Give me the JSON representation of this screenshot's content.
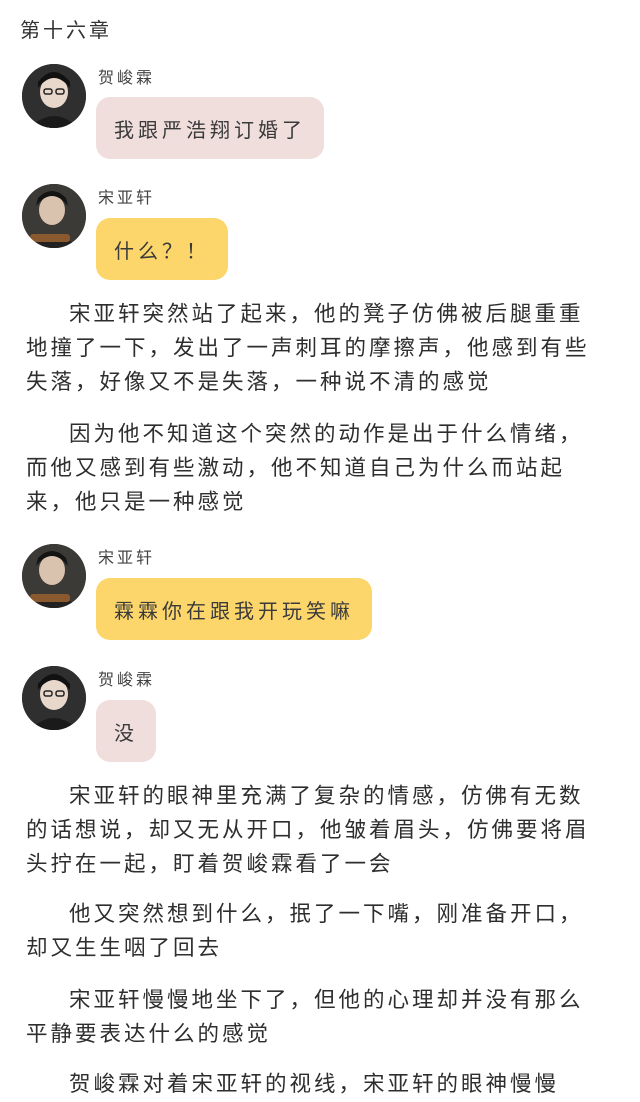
{
  "chapter": {
    "title": "第十六章"
  },
  "messages": [
    {
      "sender": "贺峻霖",
      "text": "我跟严浩翔订婚了",
      "color": "#f0dedd"
    },
    {
      "sender": "宋亚轩",
      "text": "什么？！",
      "color": "#fcd66a"
    },
    {
      "sender": "宋亚轩",
      "text": "霖霖你在跟我开玩笑嘛",
      "color": "#fcd66a"
    },
    {
      "sender": "贺峻霖",
      "text": "没",
      "color": "#f0dedd"
    }
  ],
  "paragraphs": [
    "宋亚轩突然站了起来，他的凳子仿佛被后腿重重地撞了一下，发出了一声刺耳的摩擦声，他感到有些失落，好像又不是失落，一种说不清的感觉",
    "因为他不知道这个突然的动作是出于什么情绪，而他又感到有些激动，他不知道自己为什么而站起来，他只是一种感觉",
    "宋亚轩的眼神里充满了复杂的情感，仿佛有无数的话想说，却又无从开口，他皱着眉头，仿佛要将眉头拧在一起，盯着贺峻霖看了一会",
    "他又突然想到什么，抿了一下嘴，刚准备开口，却又生生咽了回去",
    "宋亚轩慢慢地坐下了，但他的心理却并没有那么平静要表达什么的感觉",
    "贺峻霖对着宋亚轩的视线，宋亚轩的眼神慢慢"
  ]
}
